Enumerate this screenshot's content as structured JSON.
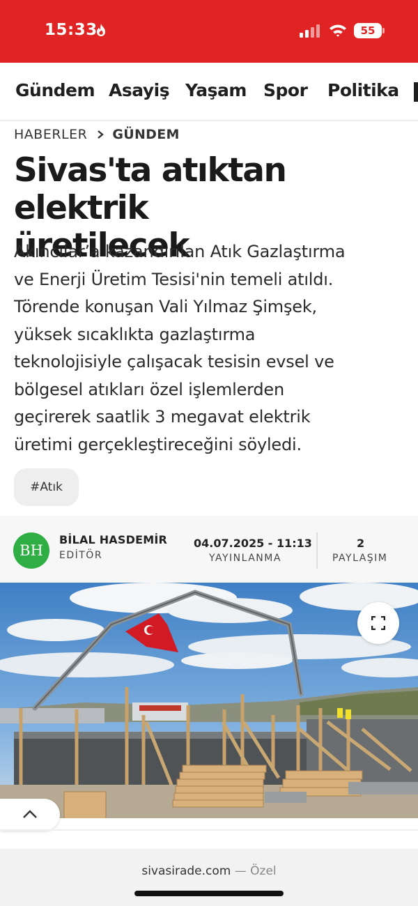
{
  "status_bar": {
    "time": "15:33",
    "battery": "55",
    "background_color": "#e02424"
  },
  "categories": [
    {
      "label": "Gündem"
    },
    {
      "label": "Asayiş"
    },
    {
      "label": "Yaşam"
    },
    {
      "label": "Spor"
    },
    {
      "label": "Politika"
    }
  ],
  "breadcrumb": {
    "home": "HABERLER",
    "current": "GÜNDEM"
  },
  "article": {
    "headline_line1": "Sivas'ta atıktan elektrik",
    "headline_line2": "üretilecek",
    "summary_lines": [
      "Akıncılar’a kazandırılan Atık Gazlaştırma",
      "ve Enerji Üretim Tesisi'nin temeli atıldı.",
      "Törende konuşan Vali Yılmaz Şimşek,",
      "yüksek sıcaklıkta gazlaştırma",
      "teknolojisiyle çalışacak tesisin evsel ve",
      "bölgesel atıkları özel işlemlerden",
      "geçirerek saatlik 3 megavat elektrik",
      "üretimi gerçekleştireceğini söyledi."
    ],
    "tag": "#Atık"
  },
  "meta": {
    "author_initials": "BH",
    "author_name": "BİLAL HASDEMİR",
    "author_role": "EDİTÖR",
    "publish_date": "04.07.2025 - 11:13",
    "publish_label": "YAYINLANMA",
    "share_count": "2",
    "share_label": "PAYLAŞIM",
    "avatar_color": "#2fae44"
  },
  "photo": {
    "icons": [
      "fullscreen-icon",
      "chevron-up-icon"
    ]
  },
  "browser": {
    "domain": "sivasirade.com",
    "suffix": " — Özel"
  }
}
